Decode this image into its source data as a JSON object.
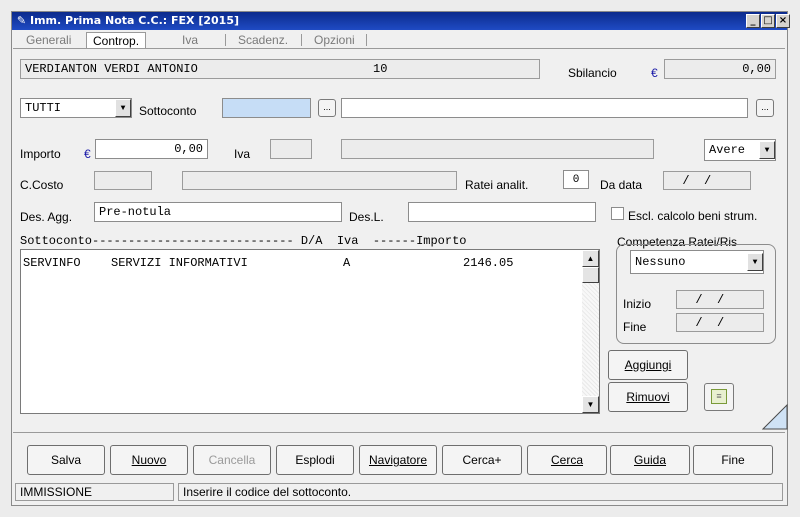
{
  "window": {
    "title": "Imm. Prima Nota C.C.: FEX  [2015]",
    "controls": {
      "minimize": "_",
      "maximize": "□",
      "close": "×"
    }
  },
  "tabs": [
    {
      "label": "Generali"
    },
    {
      "label": "Controp.",
      "active": true
    },
    {
      "label": "Iva"
    },
    {
      "label": "Scadenz."
    },
    {
      "label": "Opzioni"
    }
  ],
  "header": {
    "account_name": "VERDIANTON VERDI ANTONIO",
    "account_number": "10",
    "sbilancio_label": "Sbilancio",
    "currency_symbol": "€",
    "sbilancio_value": "0,00"
  },
  "filters": {
    "type_select": "TUTTI",
    "sottoconto_label": "Sottoconto",
    "sottoconto_code": "",
    "sottoconto_desc": "",
    "lookup_btn": "..."
  },
  "amounts": {
    "importo_label": "Importo",
    "importo_value": "0,00",
    "iva_label": "Iva",
    "iva_code": "",
    "iva_desc": "",
    "dare_avere": "Avere"
  },
  "cost": {
    "ccosto_label": "C.Costo",
    "ratei_label": "Ratei analit.",
    "ratei_value": "0",
    "dadata_label": "Da data",
    "dadata_value": "  /  /"
  },
  "desc": {
    "desagg_label": "Des. Agg.",
    "desagg_value": "Pre-notula",
    "desl_label": "Des.L.",
    "desl_value": "",
    "escl_label": "Escl. calcolo beni strum."
  },
  "list": {
    "header": "Sottoconto---------------------------- D/A  Iva  ------Importo",
    "rows": [
      {
        "code": "SERVINFO",
        "desc": "SERVIZI INFORMATIVI",
        "da": "A",
        "iva": "",
        "importo": "2146.05"
      }
    ]
  },
  "competenza": {
    "title": "Competenza Ratei/Ris",
    "select": "Nessuno",
    "inizio_label": "Inizio",
    "inizio_value": "  /  /",
    "fine_label": "Fine",
    "fine_value": "  /  /"
  },
  "side_buttons": {
    "aggiungi": "Aggiungi",
    "rimuovi": "Rimuovi"
  },
  "actions": [
    "Salva",
    "Nuovo",
    "Cancella",
    "Esplodi",
    "Navigatore",
    "Cerca+",
    "Cerca",
    "Guida",
    "Fine"
  ],
  "status": {
    "mode": "IMMISSIONE",
    "message": "Inserire il codice del sottoconto."
  }
}
